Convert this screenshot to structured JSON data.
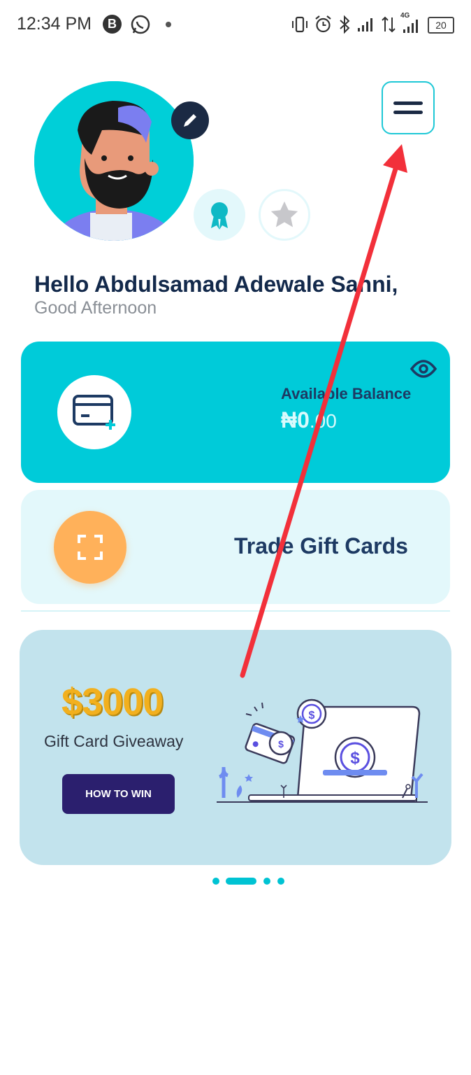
{
  "status_bar": {
    "time": "12:34 PM",
    "network": "4G",
    "battery": "20"
  },
  "header": {
    "greeting": "Hello Abdulsamad Adewale Sanni,",
    "salutation": "Good Afternoon"
  },
  "balance_card": {
    "label": "Available Balance",
    "currency": "₦",
    "amount_whole": "0",
    "amount_decimal": ".00"
  },
  "trade_card": {
    "label": "Trade Gift Cards"
  },
  "promo_banner": {
    "amount": "$3000",
    "subtitle": "Gift Card Giveaway",
    "button_label": "HOW TO WIN"
  },
  "carousel": {
    "pages": 4,
    "active_index": 1
  },
  "colors": {
    "accent": "#00cbd9",
    "navy": "#1b2a44",
    "orange": "#ffb15a",
    "promo_gold": "#f2b01e",
    "annotation_arrow": "#f2303a"
  },
  "icons": [
    "whatsapp-icon",
    "edit-icon",
    "ribbon-badge-icon",
    "star-badge-icon",
    "menu-icon",
    "wallet-card-icon",
    "eye-icon",
    "scan-icon"
  ]
}
